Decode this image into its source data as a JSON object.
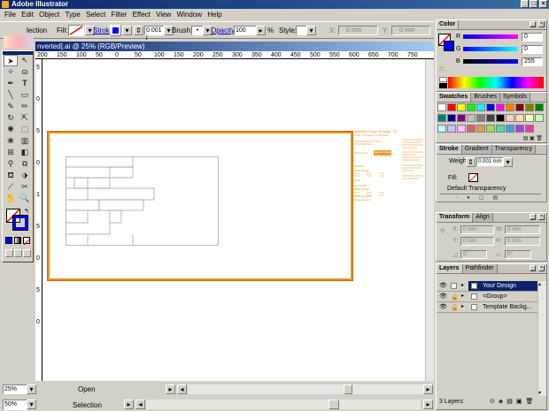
{
  "app": {
    "title": "Adobe Illustrator",
    "window_controls": [
      "_",
      "□",
      "×"
    ]
  },
  "menu": [
    "File",
    "Edit",
    "Object",
    "Type",
    "Select",
    "Filter",
    "Effect",
    "View",
    "Window",
    "Help"
  ],
  "control_bar": {
    "selection_label": "lection",
    "fill_label": "Fill:",
    "stroke_label": "Stroke:",
    "stroke_weight": "0.001 i",
    "brush_label": "Brush:",
    "opacity_label": "Opacity:",
    "opacity_value": "100",
    "percent": "%",
    "style_label": "Style:",
    "x_label": "X:",
    "x_value": "0 mm",
    "y_label": "Y:",
    "y_value": "0 mm"
  },
  "document": {
    "title": "nverted].ai @ 25% (RGB/Preview)",
    "hruler_labels": [
      "200",
      "150",
      "100",
      "50",
      "0",
      "50",
      "100",
      "150",
      "200",
      "250",
      "300",
      "350",
      "400",
      "450",
      "500",
      "550",
      "600",
      "650",
      "700",
      "750"
    ],
    "vruler_labels": [
      "5",
      "0",
      "5",
      "0",
      "1",
      "5",
      "0",
      "5",
      "0"
    ]
  },
  "status": {
    "zoom_top": "25%",
    "open_label": "Open",
    "zoom_bottom": "50%",
    "selection_label": "Selection"
  },
  "overlay_text": {
    "heading": "Illustrator Design Template - IS",
    "sub": "a line 7 0.1 Pitch 2 millimetre",
    "orange_box": "Illustrator Design Template",
    "lines": [
      "Dimensions",
      "Material",
      "Width  Height",
      "Area",
      "Line Width",
      "Width  Height",
      "Cutting Speed",
      "Speed  Power"
    ]
  },
  "color_panel": {
    "tab": "Color",
    "labels": [
      "R",
      "G",
      "B"
    ],
    "values": [
      "0",
      "0",
      "255"
    ],
    "colors": {
      "accent": "#0000ff"
    }
  },
  "swatches_panel": {
    "tabs": [
      "Swatches",
      "Brushes",
      "Symbols"
    ],
    "colors": [
      "#ffffff",
      "#ff0000",
      "#ffff00",
      "#00ff00",
      "#00ffff",
      "#0000ff",
      "#ff00ff",
      "#ff8000",
      "#800000",
      "#808000",
      "#008000",
      "#008080",
      "#000080",
      "#800080",
      "#c0c0c0",
      "#808080",
      "#404040",
      "#000000",
      "#ffcccc",
      "#ffe0b0",
      "#ffffc0",
      "#c0ffc0",
      "#c0ffff",
      "#c0c0ff",
      "#ffc0ff",
      "#e06060",
      "#e0a040",
      "#a0e040",
      "#40e0a0",
      "#40a0e0",
      "#a040e0",
      "#e040a0"
    ]
  },
  "stroke_panel": {
    "tabs": [
      "Stroke",
      "Gradient",
      "Transparency"
    ],
    "weight_label": "Weight:",
    "weight_value": "0.001 mm",
    "fill_label": "Fill:",
    "transparency": "Default Transparency"
  },
  "transform_panel": {
    "tabs": [
      "Transform",
      "Align"
    ],
    "x_label": "X:",
    "x_value": "0 mm",
    "y_label": "Y:",
    "y_value": "0 mm",
    "w_label": "W:",
    "w_value": "0 mm",
    "h_label": "H:",
    "h_value": "0 mm",
    "rot_value": "0°",
    "shear_value": "0°"
  },
  "layers_panel": {
    "tabs": [
      "Layers",
      "Pathfinder"
    ],
    "layers": [
      {
        "name": "Your Design",
        "selected": true
      },
      {
        "name": "<Group>",
        "selected": false
      },
      {
        "name": "Template Backg...",
        "selected": false
      }
    ],
    "count": "3 Layers"
  }
}
